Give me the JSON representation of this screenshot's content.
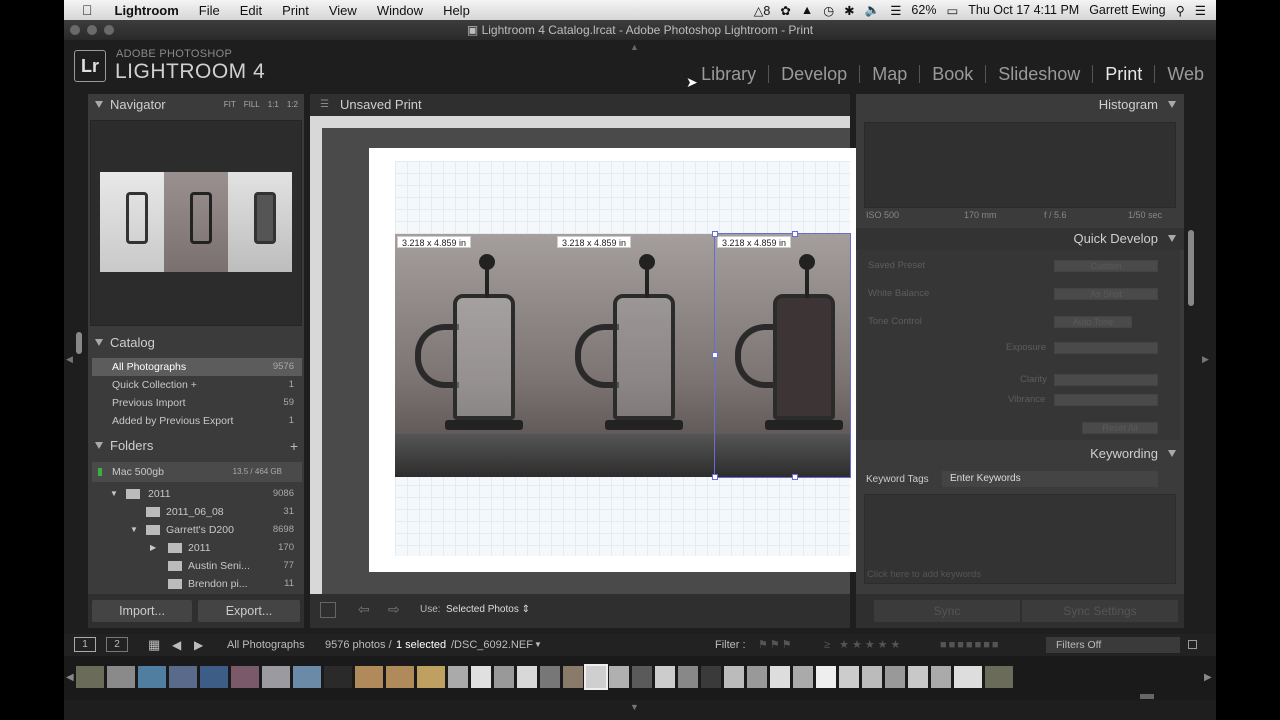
{
  "menubar": {
    "app_name": "Lightroom",
    "items": [
      "File",
      "Edit",
      "Print",
      "View",
      "Window",
      "Help"
    ],
    "status": {
      "battery": "62%",
      "datetime": "Thu Oct 17  4:11 PM",
      "user": "Garrett Ewing",
      "adobe_count": "8"
    }
  },
  "window": {
    "title": "Lightroom 4 Catalog.lrcat - Adobe Photoshop Lightroom - Print"
  },
  "identity_plate": {
    "logo": "Lr",
    "small": "ADOBE PHOTOSHOP",
    "big": "LIGHTROOM 4"
  },
  "modules": [
    "Library",
    "Develop",
    "Map",
    "Book",
    "Slideshow",
    "Print",
    "Web"
  ],
  "active_module": "Print",
  "left_panel": {
    "navigator": {
      "title": "Navigator",
      "options": [
        "FIT",
        "FILL",
        "1:1",
        "1:2"
      ]
    },
    "catalog": {
      "title": "Catalog",
      "items": [
        {
          "label": "All Photographs",
          "count": "9576"
        },
        {
          "label": "Quick Collection +",
          "count": "1"
        },
        {
          "label": "Previous Import",
          "count": "59"
        },
        {
          "label": "Added by Previous Export",
          "count": "1"
        }
      ]
    },
    "folders": {
      "title": "Folders",
      "drive": {
        "label": "Mac 500gb",
        "capacity": "13.5 / 464 GB"
      },
      "items": [
        {
          "label": "2011",
          "count": "9086",
          "level": 0
        },
        {
          "label": "2011_06_08",
          "count": "31",
          "level": 1
        },
        {
          "label": "Garrett's D200",
          "count": "8698",
          "level": 1
        },
        {
          "label": "2011",
          "count": "170",
          "level": 2
        },
        {
          "label": "Austin Seni...",
          "count": "77",
          "level": 2
        },
        {
          "label": "Brendon pi...",
          "count": "11",
          "level": 2
        }
      ]
    },
    "import_label": "Import...",
    "export_label": "Export..."
  },
  "center": {
    "layout_title": "Unsaved Print",
    "cell_labels": [
      "3.218 x 4.859 in",
      "3.218 x 4.859 in",
      "3.218 x 4.859 in"
    ],
    "toolbar": {
      "use_label": "Use:",
      "use_value": "Selected Photos"
    }
  },
  "right_panel": {
    "histogram": {
      "title": "Histogram",
      "iso": "ISO 500",
      "focal": "170 mm",
      "aperture": "f / 5.6",
      "shutter": "1/50 sec"
    },
    "quick_develop": {
      "title": "Quick Develop",
      "saved_preset": {
        "label": "Saved Preset",
        "value": "Custom"
      },
      "white_balance": {
        "label": "White Balance",
        "value": "As Shot"
      },
      "tone_control": {
        "label": "Tone Control",
        "value": "Auto Tone"
      },
      "exposure": "Exposure",
      "clarity": "Clarity",
      "vibrance": "Vibrance",
      "reset": "Reset All"
    },
    "keywording": {
      "title": "Keywording",
      "tags_label": "Keyword Tags",
      "tags_value": "Enter Keywords",
      "placeholder": "Click here to add keywords"
    },
    "sync_label": "Sync",
    "sync_settings_label": "Sync Settings"
  },
  "filmstrip": {
    "source": "All Photographs",
    "photos_count": "9576 photos /",
    "selected": "1 selected",
    "filename": "/DSC_6092.NEF",
    "filter_label": "Filter :",
    "filter_value": "Filters Off",
    "page_buttons": [
      "1",
      "2"
    ]
  }
}
